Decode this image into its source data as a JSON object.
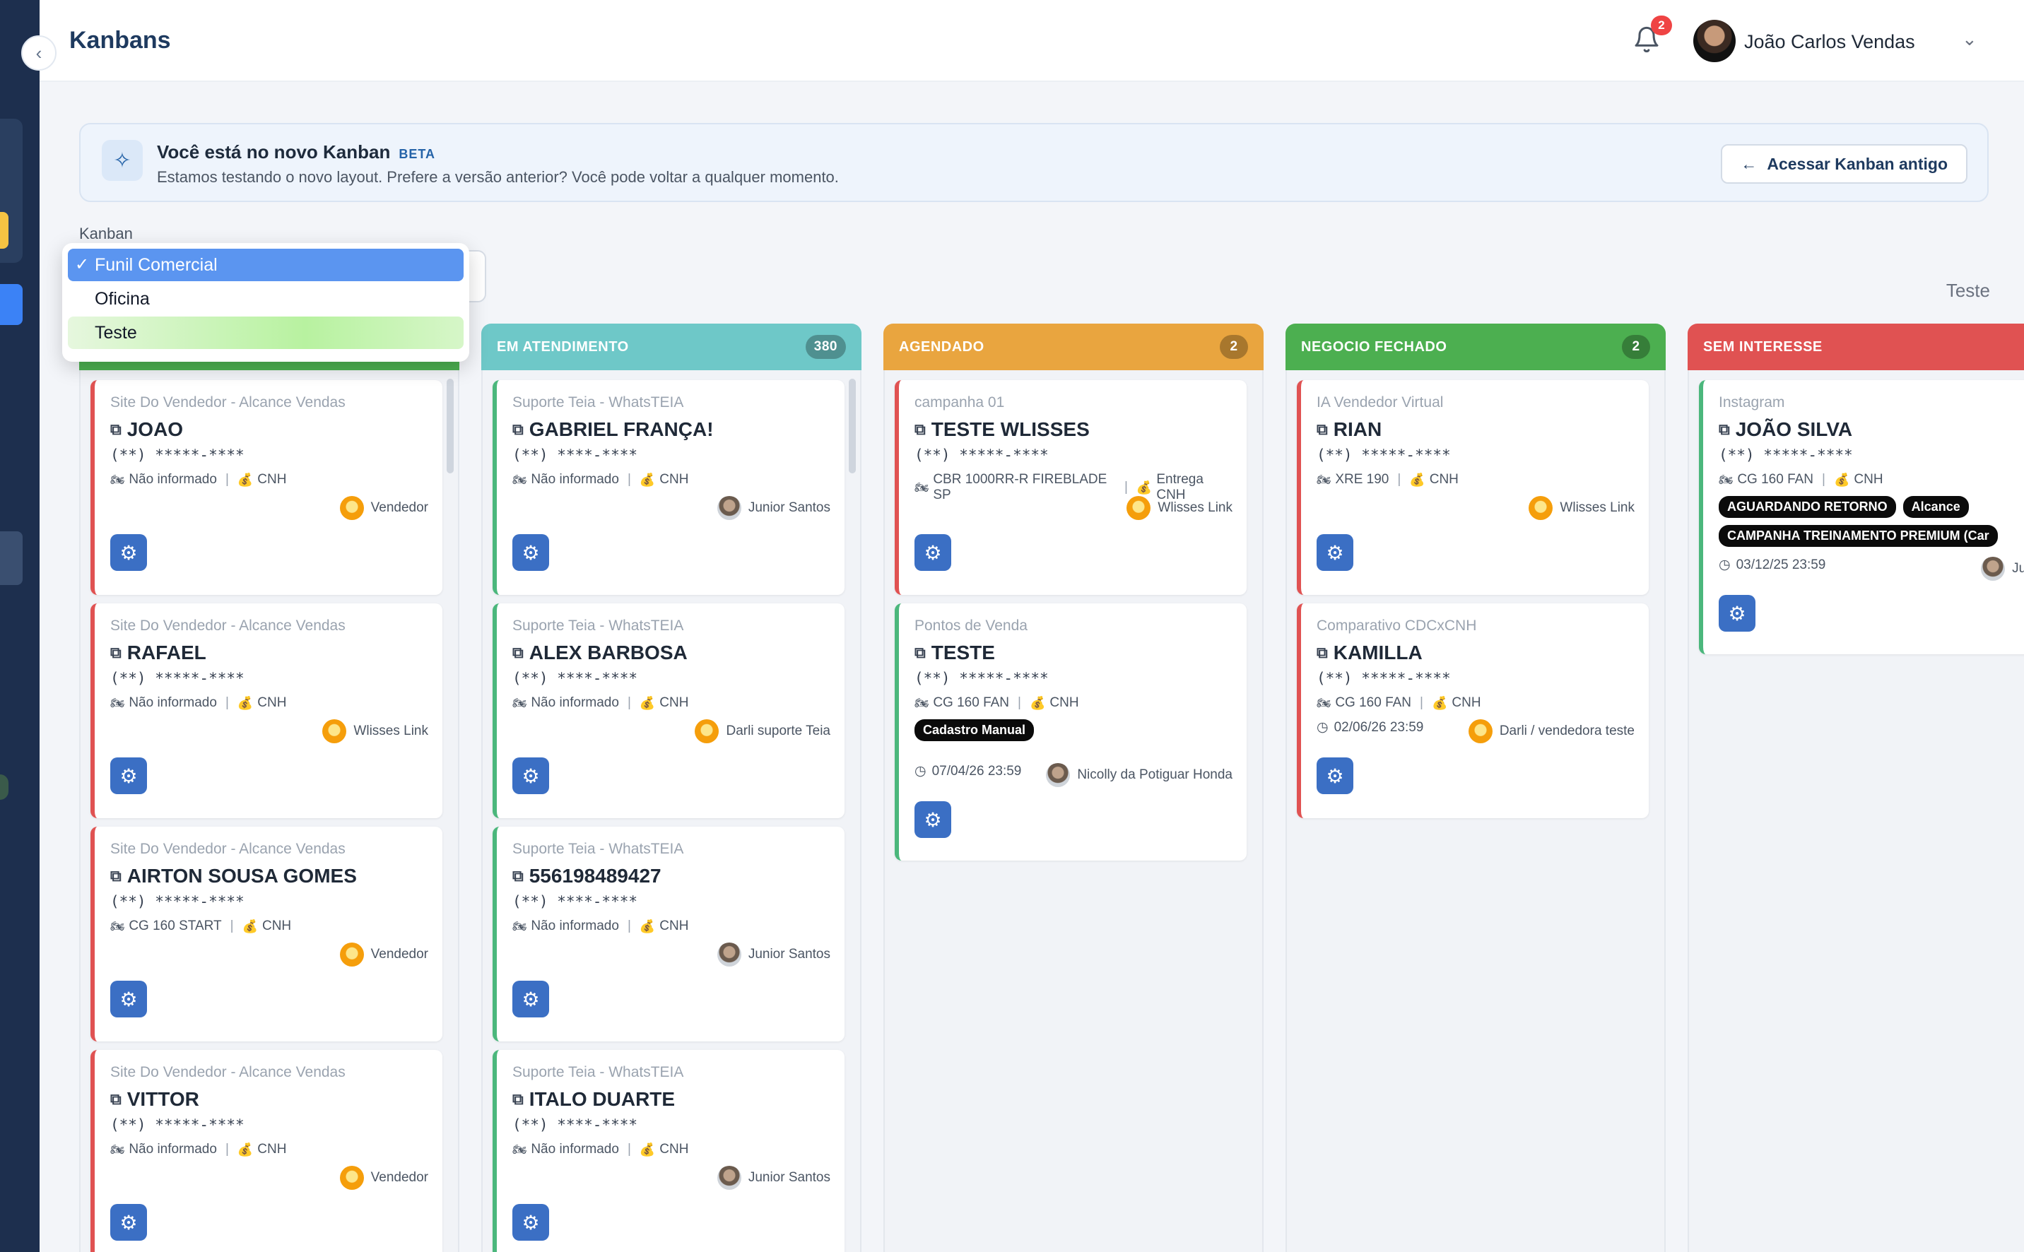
{
  "header": {
    "title": "Kanbans",
    "notifications": "2",
    "user_name": "João Carlos Vendas"
  },
  "banner": {
    "title": "Você está no novo Kanban",
    "tag": "BETA",
    "subtitle": "Estamos testando o novo layout. Prefere a versão anterior? Você pode voltar a qualquer momento.",
    "old_button": "Acessar Kanban antigo"
  },
  "kanban_select": {
    "label": "Kanban",
    "options": [
      "Funil Comercial",
      "Oficina",
      "Teste"
    ],
    "selected": "Funil Comercial"
  },
  "top_right_label": "Teste",
  "columns": [
    {
      "title": "",
      "count": "",
      "color": "#4caf50",
      "cards": [
        {
          "source": "Site Do Vendedor - Alcance Vendas",
          "name": "JOAO",
          "phone": "(**) *****-****",
          "vehicle": "Não informado",
          "doc": "CNH",
          "owner": "Vendedor"
        },
        {
          "source": "Site Do Vendedor - Alcance Vendas",
          "name": "RAFAEL",
          "phone": "(**) *****-****",
          "vehicle": "Não informado",
          "doc": "CNH",
          "owner": "Wlisses Link"
        },
        {
          "source": "Site Do Vendedor - Alcance Vendas",
          "name": "AIRTON SOUSA GOMES",
          "phone": "(**) *****-****",
          "vehicle": "CG 160 START",
          "doc": "CNH",
          "owner": "Vendedor"
        },
        {
          "source": "Site Do Vendedor - Alcance Vendas",
          "name": "VITTOR",
          "phone": "(**) *****-****",
          "vehicle": "Não informado",
          "doc": "CNH",
          "owner": "Vendedor"
        }
      ]
    },
    {
      "title": "EM ATENDIMENTO",
      "count": "380",
      "color": "#6ec8c8",
      "cards": [
        {
          "source": "Suporte Teia - WhatsTEIA",
          "name": "GABRIEL FRANÇA!",
          "phone": "(**) ****-****",
          "vehicle": "Não informado",
          "doc": "CNH",
          "owner": "Junior Santos"
        },
        {
          "source": "Suporte Teia - WhatsTEIA",
          "name": "ALEX BARBOSA",
          "phone": "(**) ****-****",
          "vehicle": "Não informado",
          "doc": "CNH",
          "owner": "Darli suporte Teia"
        },
        {
          "source": "Suporte Teia - WhatsTEIA",
          "name": "556198489427",
          "phone": "(**) ****-****",
          "vehicle": "Não informado",
          "doc": "CNH",
          "owner": "Junior Santos"
        },
        {
          "source": "Suporte Teia - WhatsTEIA",
          "name": "ITALO DUARTE",
          "phone": "(**) ****-****",
          "vehicle": "Não informado",
          "doc": "CNH",
          "owner": "Junior Santos"
        }
      ]
    },
    {
      "title": "AGENDADO",
      "count": "2",
      "color": "#e9a53f",
      "cards": [
        {
          "source": "campanha 01",
          "name": "TESTE WLISSES",
          "phone": "(**) *****-****",
          "vehicle": "CBR 1000RR-R FIREBLADE SP",
          "doc": "Entrega CNH",
          "owner": "Wlisses Link"
        },
        {
          "source": "Pontos de Venda",
          "name": "TESTE",
          "phone": "(**) *****-****",
          "vehicle": "CG 160 FAN",
          "doc": "CNH",
          "tags": [
            "Cadastro Manual"
          ],
          "date": "07/04/26 23:59",
          "owner": "Nicolly da Potiguar Honda"
        }
      ]
    },
    {
      "title": "NEGOCIO FECHADO",
      "count": "2",
      "color": "#4caf50",
      "cards": [
        {
          "source": "IA Vendedor Virtual",
          "name": "RIAN",
          "phone": "(**) *****-****",
          "vehicle": "XRE 190",
          "doc": "CNH",
          "owner": "Wlisses Link"
        },
        {
          "source": "Comparativo CDCxCNH",
          "name": "KAMILLA",
          "phone": "(**) *****-****",
          "vehicle": "CG 160 FAN",
          "doc": "CNH",
          "date": "02/06/26 23:59",
          "owner": "Darli / vendedora teste"
        }
      ]
    },
    {
      "title": "SEM INTERESSE",
      "count": "",
      "color": "#e05252",
      "cards": [
        {
          "source": "Instagram",
          "name": "JOÃO SILVA",
          "phone": "(**) *****-****",
          "vehicle": "CG 160 FAN",
          "doc": "CNH",
          "tags": [
            "AGUARDANDO RETORNO",
            "Alcance",
            "CAMPANHA TREINAMENTO PREMIUM (Car"
          ],
          "date": "03/12/25 23:59",
          "owner": "Juni"
        }
      ]
    }
  ]
}
